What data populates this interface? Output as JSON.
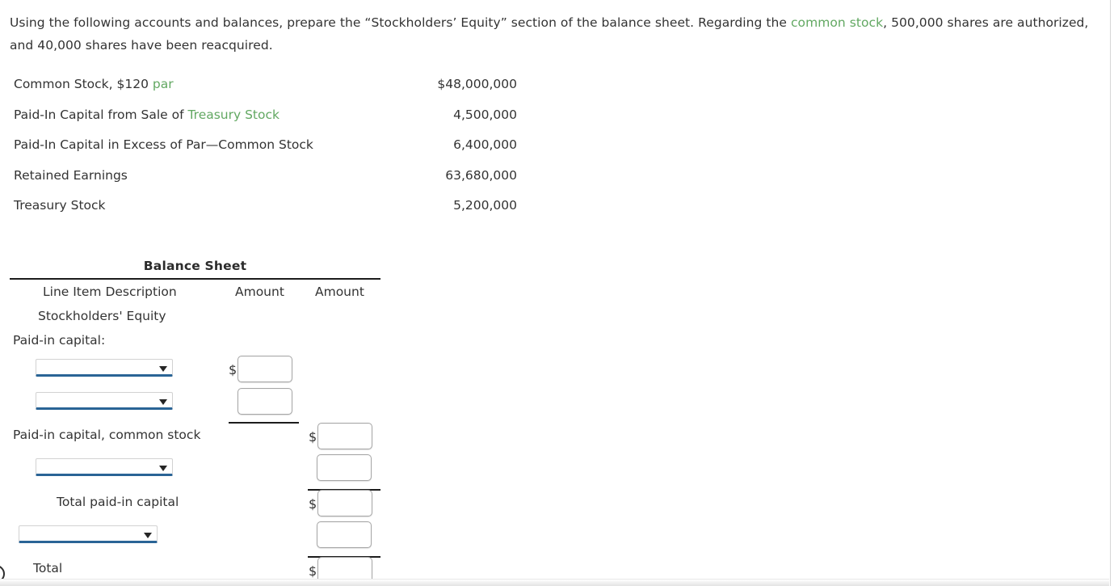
{
  "prompt": {
    "part1": "Using the following accounts and balances, prepare the “Stockholders’ Equity” section of the balance sheet. Regarding the ",
    "link1": "common stock",
    "part2": ", 500,000 shares are authorized, and 40,000 shares have been reacquired."
  },
  "accounts": [
    {
      "name_pre": "Common Stock, $120 ",
      "name_link": "par",
      "name_post": "",
      "amount": "$48,000,000"
    },
    {
      "name_pre": "Paid-In Capital from Sale of ",
      "name_link": "Treasury Stock",
      "name_post": "",
      "amount": "4,500,000"
    },
    {
      "name_pre": "Paid-In Capital in Excess of Par—Common Stock",
      "name_link": "",
      "name_post": "",
      "amount": "6,400,000"
    },
    {
      "name_pre": "Retained Earnings",
      "name_link": "",
      "name_post": "",
      "amount": "63,680,000"
    },
    {
      "name_pre": "Treasury Stock",
      "name_link": "",
      "name_post": "",
      "amount": "5,200,000"
    }
  ],
  "sheet": {
    "title": "Balance Sheet",
    "headers": {
      "description": "Line Item Description",
      "amount1": "Amount",
      "amount2": "Amount"
    },
    "labels": {
      "stockholders_equity": "Stockholders' Equity",
      "paid_in_capital": "Paid-in capital:",
      "paid_in_capital_common_stock": "Paid-in capital, common stock",
      "total_paid_in_capital": "Total paid-in capital",
      "total": "Total"
    },
    "dropdowns": [
      {
        "value": "",
        "placeholder": ""
      },
      {
        "value": "",
        "placeholder": ""
      },
      {
        "value": "",
        "placeholder": ""
      },
      {
        "value": "",
        "placeholder": ""
      }
    ],
    "inputs": [
      {
        "value": "",
        "placeholder": ""
      },
      {
        "value": "",
        "placeholder": ""
      },
      {
        "value": "",
        "placeholder": ""
      },
      {
        "value": "",
        "placeholder": ""
      },
      {
        "value": "",
        "placeholder": ""
      },
      {
        "value": "",
        "placeholder": ""
      },
      {
        "value": "",
        "placeholder": ""
      }
    ],
    "currency_symbol": "$"
  },
  "colors": {
    "link_green": "#62a862",
    "select_underline_blue": "#2a6496",
    "rule_black": "#1c1c1c"
  }
}
